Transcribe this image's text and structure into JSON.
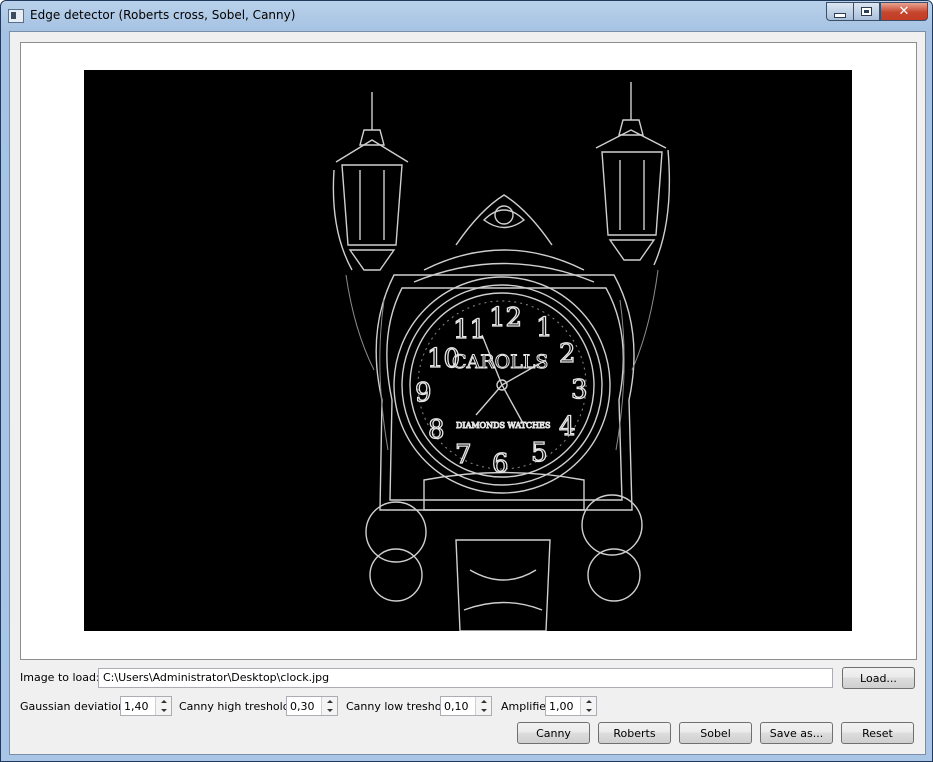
{
  "window": {
    "title": "Edge detector (Roberts cross, Sobel, Canny)",
    "close_glyph": "✕"
  },
  "image": {
    "icon": "edge-detected-image",
    "clock_labels": {
      "brand": "CAROLLS",
      "subtitle": "DIAMONDS WATCHES",
      "numerals": [
        "12",
        "1",
        "2",
        "3",
        "4",
        "5",
        "6",
        "7",
        "8",
        "9",
        "10",
        "11"
      ]
    }
  },
  "load_row": {
    "label": "Image to load:",
    "path": "C:\\Users\\Administrator\\Desktop\\clock.jpg",
    "load_button": "Load..."
  },
  "params": {
    "gaussian_label": "Gaussian deviation:",
    "gaussian_value": "1,40",
    "canny_high_label": "Canny high treshold:",
    "canny_high_value": "0,30",
    "canny_low_label": "Canny low treshold:",
    "canny_low_value": "0,10",
    "amplifier_label": "Amplifier:",
    "amplifier_value": "1,00"
  },
  "actions": {
    "canny": "Canny",
    "roberts": "Roberts",
    "sobel": "Sobel",
    "save_as": "Save as...",
    "reset": "Reset"
  }
}
